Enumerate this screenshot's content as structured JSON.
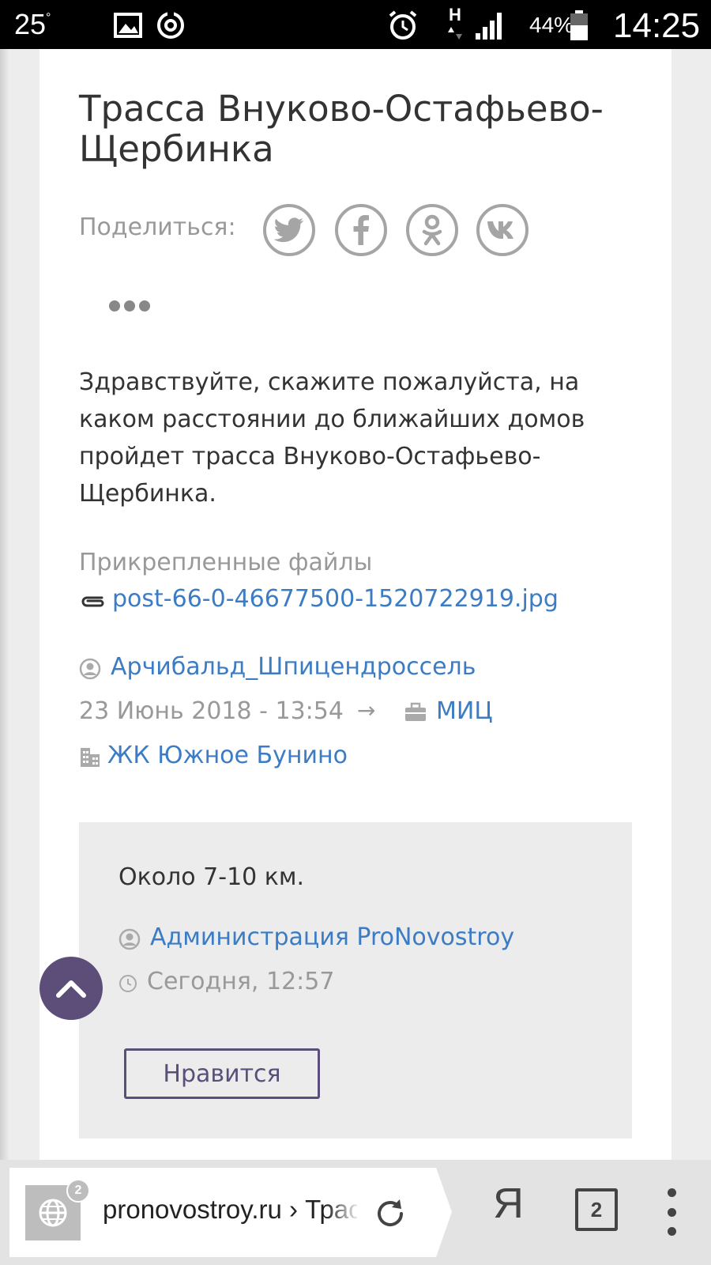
{
  "status_bar": {
    "temperature": "25",
    "degree": "°",
    "network": "H",
    "battery": "44%",
    "time": "14:25"
  },
  "post": {
    "title": "Трасса Внуково-Остафьево-Щербинка",
    "share_label": "Поделиться:",
    "share_icons": [
      "twitter-icon",
      "facebook-icon",
      "odnoklassniki-icon",
      "vk-icon"
    ],
    "question": "Здравствуйте, скажите пожалуйста, на каком расстоянии до ближайших домов пройдет трасса Внуково-Остафьево-Щербинка.",
    "attached_label": "Прикрепленные файлы",
    "attached_file": "post-66-0-46677500-1520722919.jpg",
    "author": "Арчибальд_Шпицендроссель",
    "date": "23 Июнь 2018 - 13:54",
    "arrow": "→",
    "category": "МИЦ",
    "complex": "ЖК Южное Бунино"
  },
  "answer": {
    "text": "Около 7-10 км.",
    "author": "Администрация ProNovostroy",
    "time": "Сегодня, 12:57",
    "like_label": "Нравится"
  },
  "browser": {
    "tabs_badge": "2",
    "url": "pronovostroy.ru › Трасса Внуково-Остафьево-Щербинка",
    "yandex_label": "Я",
    "tabs_count": "2"
  },
  "colors": {
    "link": "#3b7cc4",
    "accent": "#5c4e78",
    "muted": "#999999"
  }
}
